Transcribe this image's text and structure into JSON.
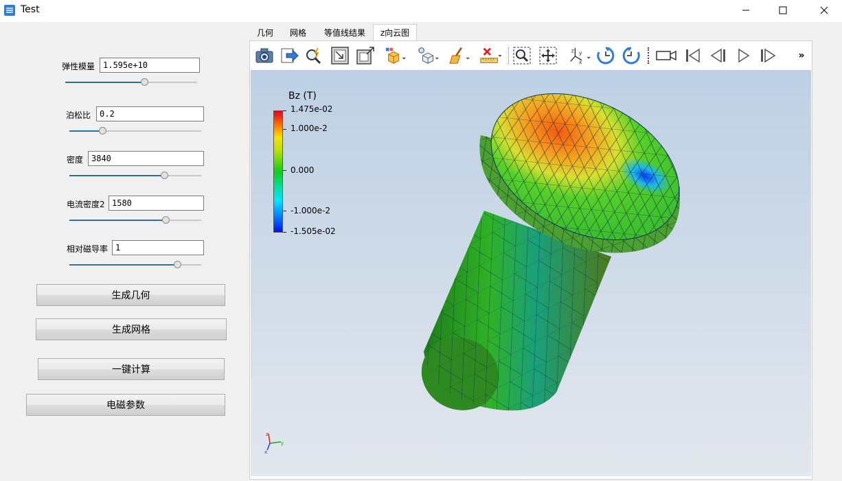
{
  "window": {
    "title": "Test",
    "controls": {
      "minimize": "minimize",
      "maximize": "maximize",
      "close": "close"
    }
  },
  "params": [
    {
      "label": "弹性模量",
      "value": "1.595e+10",
      "slider_fraction": 0.6
    },
    {
      "label": "泊松比",
      "value": "0.2",
      "slider_fraction": 0.25
    },
    {
      "label": "密度",
      "value": "3840",
      "slider_fraction": 0.72
    },
    {
      "label": "电流密度2",
      "value": "1580",
      "slider_fraction": 0.73
    },
    {
      "label": "相对磁导率",
      "value": "1",
      "slider_fraction": 0.82
    }
  ],
  "buttons": {
    "generate_geometry": "生成几何",
    "generate_mesh": "生成网格",
    "compute": "一键计算",
    "em_params": "电磁参数"
  },
  "tabs": [
    {
      "label": "几何",
      "active": false
    },
    {
      "label": "网格",
      "active": false
    },
    {
      "label": "等值线结果",
      "active": false
    },
    {
      "label": "z向云图",
      "active": true
    }
  ],
  "toolbar": {
    "icons": [
      "camera-icon",
      "export-icon",
      "probe-icon",
      "reset-view-icon",
      "zoom-box-icon",
      "display-mode-icon",
      "lighting-icon",
      "clear-icon",
      "ruler-icon",
      "zoom-selection-icon",
      "fit-view-icon",
      "axes-orientation-icon",
      "rotate-cw-icon",
      "rotate-ccw-icon",
      "video-camera-icon",
      "first-frame-icon",
      "previous-frame-icon",
      "play-icon",
      "next-frame-icon",
      "more-icon"
    ],
    "more_label": "»"
  },
  "scalar_bar": {
    "title": "Bz (T)",
    "ticks": [
      "1.475e-02",
      "1.000e-2",
      "0.000",
      "-1.000e-2",
      "-1.505e-02"
    ],
    "colors": {
      "max": "#e8001c",
      "mid": "#12cc1a",
      "min": "#0010ff"
    }
  },
  "orientation_axes": {
    "x": "x",
    "y": "y",
    "z": "z"
  }
}
